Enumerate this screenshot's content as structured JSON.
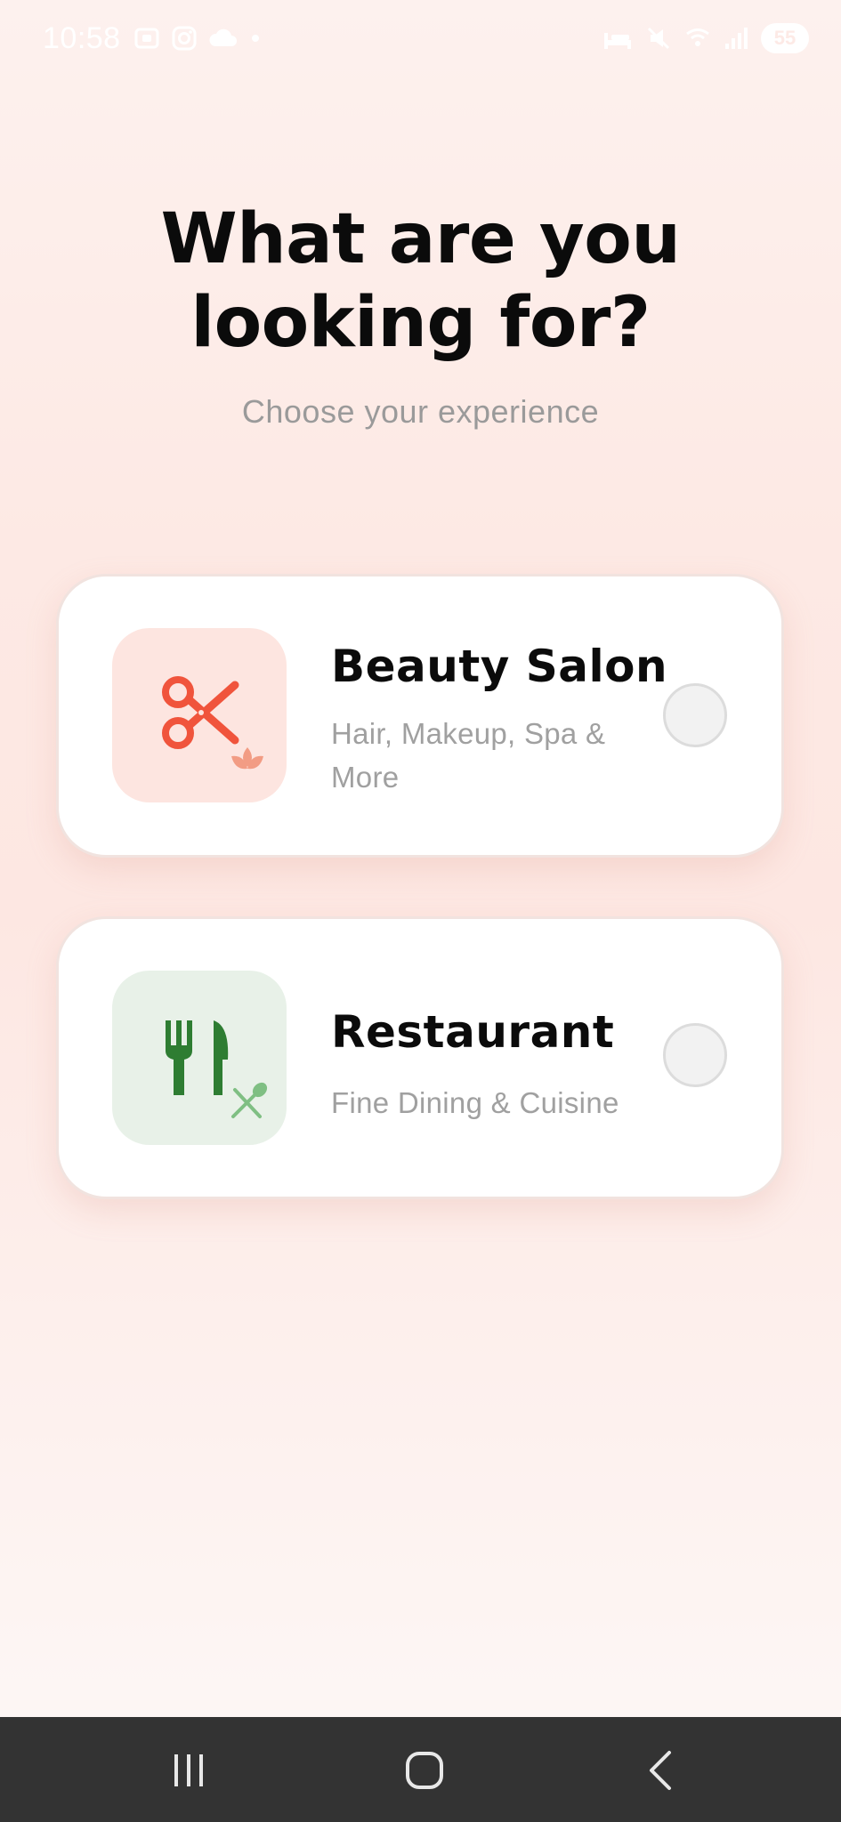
{
  "status_bar": {
    "time": "10:58",
    "battery": "55",
    "left_icons": [
      "screenshot-icon",
      "instagram-icon",
      "cloud-icon",
      "dot-icon"
    ],
    "right_icons": [
      "bed-icon",
      "mute-icon",
      "wifi-icon",
      "signal-icon"
    ]
  },
  "heading": {
    "line1": "What are you",
    "line2": "looking for?",
    "subtitle": "Choose your experience"
  },
  "options": [
    {
      "title": "Beauty Salon",
      "description": "Hair, Makeup, Spa & More",
      "icon": "scissors-lotus-icon",
      "icon_color": "#f0543c",
      "icon_bg": "#fde5e0",
      "selected": false
    },
    {
      "title": "Restaurant",
      "description": "Fine Dining & Cuisine",
      "icon": "fork-knife-icon",
      "icon_color": "#2e7d32",
      "icon_bg": "#e8f1e8",
      "selected": false
    }
  ],
  "nav_bar": {
    "buttons": [
      "recents-icon",
      "home-icon",
      "back-icon"
    ]
  }
}
